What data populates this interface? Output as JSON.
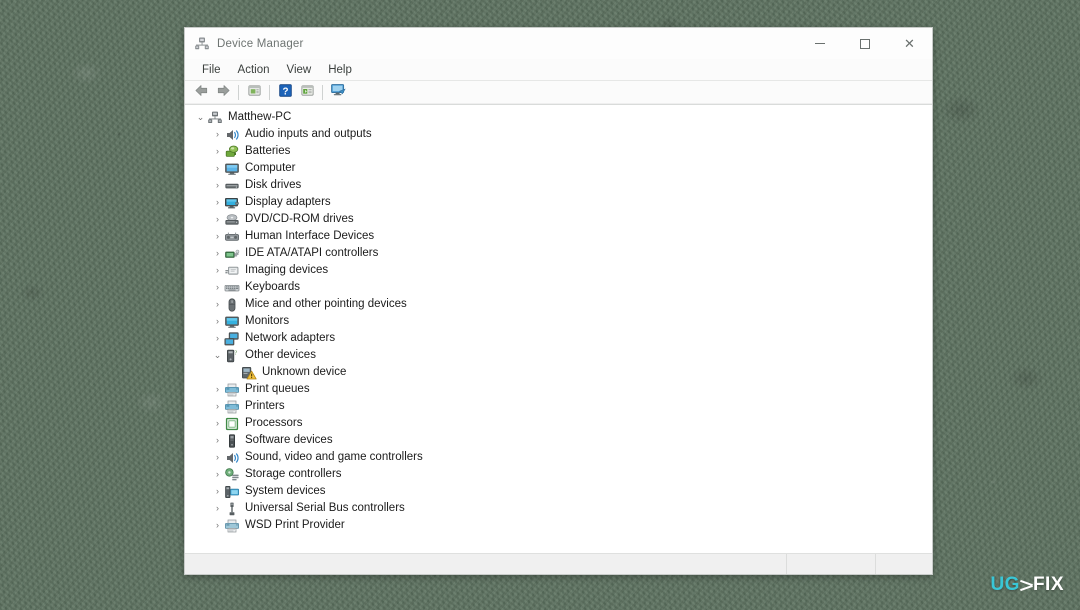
{
  "desktop": {
    "background_color": "#5d7260"
  },
  "window": {
    "title": "Device Manager",
    "title_icon": "device-manager-icon",
    "controls": {
      "minimize_label": "–",
      "maximize_label": "□",
      "close_label": "✕"
    }
  },
  "menubar": {
    "items": [
      {
        "label": "File"
      },
      {
        "label": "Action"
      },
      {
        "label": "View"
      },
      {
        "label": "Help"
      }
    ]
  },
  "toolbar": {
    "buttons": [
      {
        "name": "back-arrow-icon",
        "title": "Back"
      },
      {
        "name": "forward-arrow-icon",
        "title": "Forward"
      },
      {
        "name": "properties-icon",
        "title": "Properties"
      },
      {
        "name": "help-icon",
        "title": "Help"
      },
      {
        "name": "update-driver-icon",
        "title": "Update driver"
      },
      {
        "name": "scan-hardware-changes-icon",
        "title": "Scan for hardware changes"
      }
    ]
  },
  "tree": {
    "root": {
      "label": "Matthew-PC",
      "expanded": true,
      "icon": "computer-root-icon",
      "depth": 0
    },
    "items": [
      {
        "label": "Audio inputs and outputs",
        "icon": "speaker-icon",
        "expandable": true,
        "expanded": false,
        "depth": 1
      },
      {
        "label": "Batteries",
        "icon": "battery-icon",
        "expandable": true,
        "expanded": false,
        "depth": 1
      },
      {
        "label": "Computer",
        "icon": "monitor-icon",
        "expandable": true,
        "expanded": false,
        "depth": 1
      },
      {
        "label": "Disk drives",
        "icon": "disk-drive-icon",
        "expandable": true,
        "expanded": false,
        "depth": 1
      },
      {
        "label": "Display adapters",
        "icon": "display-adapter-icon",
        "expandable": true,
        "expanded": false,
        "depth": 1
      },
      {
        "label": "DVD/CD-ROM drives",
        "icon": "dvd-drive-icon",
        "expandable": true,
        "expanded": false,
        "depth": 1
      },
      {
        "label": "Human Interface Devices",
        "icon": "hid-icon",
        "expandable": true,
        "expanded": false,
        "depth": 1
      },
      {
        "label": "IDE ATA/ATAPI controllers",
        "icon": "ide-controller-icon",
        "expandable": true,
        "expanded": false,
        "depth": 1
      },
      {
        "label": "Imaging devices",
        "icon": "imaging-device-icon",
        "expandable": true,
        "expanded": false,
        "depth": 1
      },
      {
        "label": "Keyboards",
        "icon": "keyboard-icon",
        "expandable": true,
        "expanded": false,
        "depth": 1
      },
      {
        "label": "Mice and other pointing devices",
        "icon": "mouse-icon",
        "expandable": true,
        "expanded": false,
        "depth": 1
      },
      {
        "label": "Monitors",
        "icon": "monitor-icon",
        "expandable": true,
        "expanded": false,
        "depth": 1
      },
      {
        "label": "Network adapters",
        "icon": "network-adapter-icon",
        "expandable": true,
        "expanded": false,
        "depth": 1
      },
      {
        "label": "Other devices",
        "icon": "other-device-icon",
        "expandable": true,
        "expanded": true,
        "depth": 1
      },
      {
        "label": "Unknown device",
        "icon": "unknown-device-warning-icon",
        "expandable": false,
        "expanded": false,
        "depth": 2,
        "warning": true
      },
      {
        "label": "Print queues",
        "icon": "printer-icon",
        "expandable": true,
        "expanded": false,
        "depth": 1
      },
      {
        "label": "Printers",
        "icon": "printer-icon",
        "expandable": true,
        "expanded": false,
        "depth": 1
      },
      {
        "label": "Processors",
        "icon": "processor-icon",
        "expandable": true,
        "expanded": false,
        "depth": 1
      },
      {
        "label": "Software devices",
        "icon": "software-device-icon",
        "expandable": true,
        "expanded": false,
        "depth": 1
      },
      {
        "label": "Sound, video and game controllers",
        "icon": "speaker-icon",
        "expandable": true,
        "expanded": false,
        "depth": 1
      },
      {
        "label": "Storage controllers",
        "icon": "storage-controller-icon",
        "expandable": true,
        "expanded": false,
        "depth": 1
      },
      {
        "label": "System devices",
        "icon": "system-device-icon",
        "expandable": true,
        "expanded": false,
        "depth": 1
      },
      {
        "label": "Universal Serial Bus controllers",
        "icon": "usb-icon",
        "expandable": true,
        "expanded": false,
        "depth": 1
      },
      {
        "label": "WSD Print Provider",
        "icon": "printer-icon",
        "expandable": true,
        "expanded": false,
        "depth": 1
      }
    ],
    "chevron_collapsed": "›",
    "chevron_expanded": "⌄"
  },
  "statusbar": {
    "text": ""
  },
  "watermark": {
    "part1": "UG",
    "part2": "FIX",
    "mark": "scissors-mark"
  }
}
